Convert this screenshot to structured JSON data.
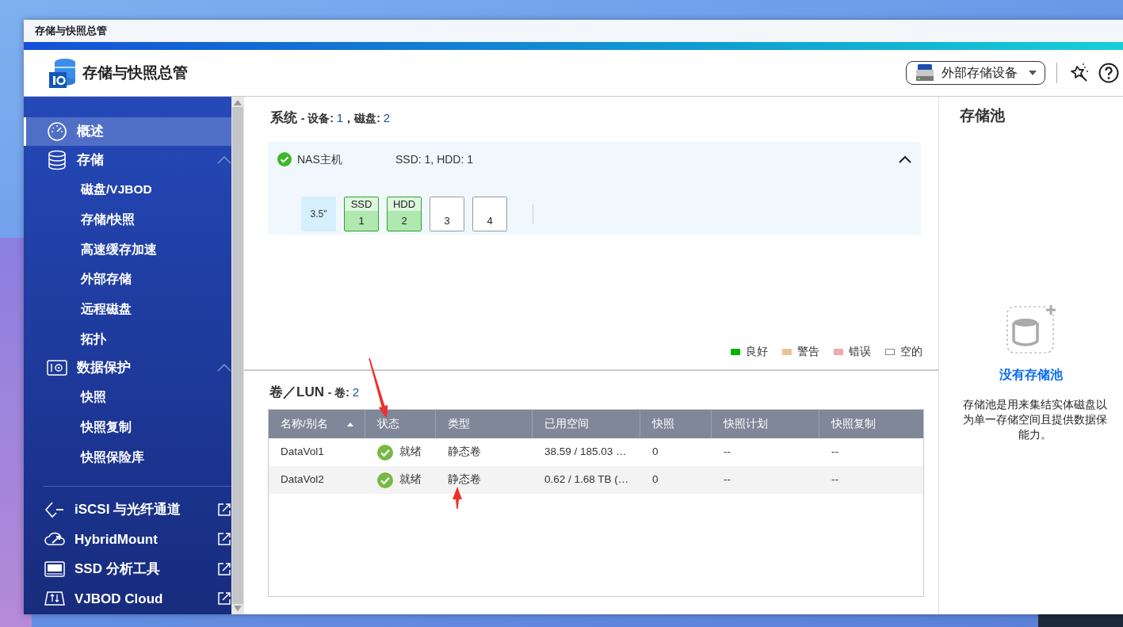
{
  "window": {
    "title": "存储与快照总管"
  },
  "header": {
    "app_title": "存储与快照总管",
    "device_button": "外部存储设备"
  },
  "sidebar": {
    "items": [
      {
        "kind": "page",
        "label": "概述",
        "selected": true
      },
      {
        "kind": "group",
        "label": "存储",
        "expanded": true,
        "children": [
          {
            "label": "磁盘/VJBOD",
            "selected": false
          },
          {
            "label": "存储/快照",
            "selected": false
          },
          {
            "label": "高速缓存加速",
            "selected": false
          },
          {
            "label": "外部存储",
            "selected": false
          },
          {
            "label": "远程磁盘",
            "selected": false
          },
          {
            "label": "拓扑",
            "selected": false
          }
        ]
      },
      {
        "kind": "group",
        "label": "数据保护",
        "expanded": true,
        "children": [
          {
            "label": "快照",
            "selected": false
          },
          {
            "label": "快照复制",
            "selected": false
          },
          {
            "label": "快照保险库",
            "selected": false
          }
        ]
      },
      {
        "kind": "external",
        "label": "iSCSI 与光纤通道"
      },
      {
        "kind": "external",
        "label": "HybridMount"
      },
      {
        "kind": "external",
        "label": "SSD 分析工具"
      },
      {
        "kind": "external",
        "label": "VJBOD Cloud"
      }
    ]
  },
  "system": {
    "title": "系统",
    "devices_label": "- 设备:",
    "devices": "1",
    "disks_label": "，磁盘:",
    "disks": "2",
    "host": {
      "name": "NAS主机",
      "summary": "SSD: 1, HDD: 1",
      "expanded": true,
      "bay_size": "3.5\"",
      "slots": [
        {
          "type": "SSD",
          "number": "1",
          "occupied": true
        },
        {
          "type": "HDD",
          "number": "2",
          "occupied": true
        },
        {
          "number": "3",
          "occupied": false
        },
        {
          "number": "4",
          "occupied": false
        }
      ]
    }
  },
  "legend": [
    {
      "label": "良好",
      "color": "#00b400"
    },
    {
      "label": "警告",
      "color": "#ecc398"
    },
    {
      "label": "错误",
      "color": "#f0aaaa"
    },
    {
      "label": "空的",
      "color": "#ffffff"
    }
  ],
  "volumes": {
    "title": "卷／LUN",
    "count_label": "- 卷:",
    "count": "2",
    "columns": [
      {
        "label": "名称/别名",
        "sorted": true
      },
      {
        "label": "状态",
        "sorted": false
      },
      {
        "label": "类型",
        "sorted": false
      },
      {
        "label": "已用空间",
        "sorted": false
      },
      {
        "label": "快照",
        "sorted": false
      },
      {
        "label": "快照计划",
        "sorted": false
      },
      {
        "label": "快照复制",
        "sorted": false
      }
    ],
    "rows": [
      {
        "name": "DataVol1",
        "status": "就绪",
        "type": "静态卷",
        "used": "38.59 / 185.03 …",
        "snapshots": "0",
        "schedule": "--",
        "replication": "--"
      },
      {
        "name": "DataVol2",
        "status": "就绪",
        "type": "静态卷",
        "used": "0.62 / 1.68 TB (…",
        "snapshots": "0",
        "schedule": "--",
        "replication": "--"
      }
    ]
  },
  "storage_pool": {
    "title": "存储池",
    "empty_title": "没有存储池",
    "description_lines": [
      "存储池是用来集结实体磁盘以",
      "为单一存储空间且提供数据保",
      "能力。"
    ]
  }
}
